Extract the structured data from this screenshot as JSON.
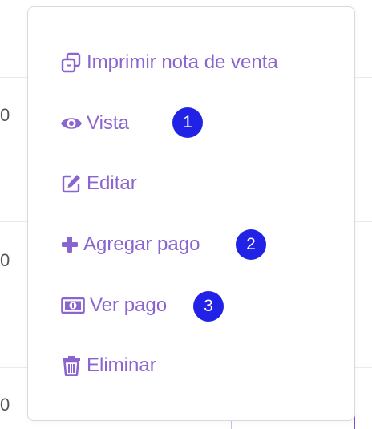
{
  "background_table": {
    "cells": [
      "0",
      "0",
      "0"
    ]
  },
  "menu": {
    "items": [
      {
        "label": "Imprimir nota de venta",
        "icon": "copy-icon"
      },
      {
        "label": "Vista",
        "icon": "eye-icon"
      },
      {
        "label": "Editar",
        "icon": "edit-icon"
      },
      {
        "label": "Agregar pago",
        "icon": "plus-icon"
      },
      {
        "label": "Ver pago",
        "icon": "money-bill-icon"
      },
      {
        "label": "Eliminar",
        "icon": "trash-icon"
      }
    ]
  },
  "badges": [
    "1",
    "2",
    "3"
  ],
  "colors": {
    "menu_text": "#8a64cf",
    "badge_bg": "#2222e6",
    "badge_text": "#ffffff",
    "border": "#d9d9de"
  }
}
